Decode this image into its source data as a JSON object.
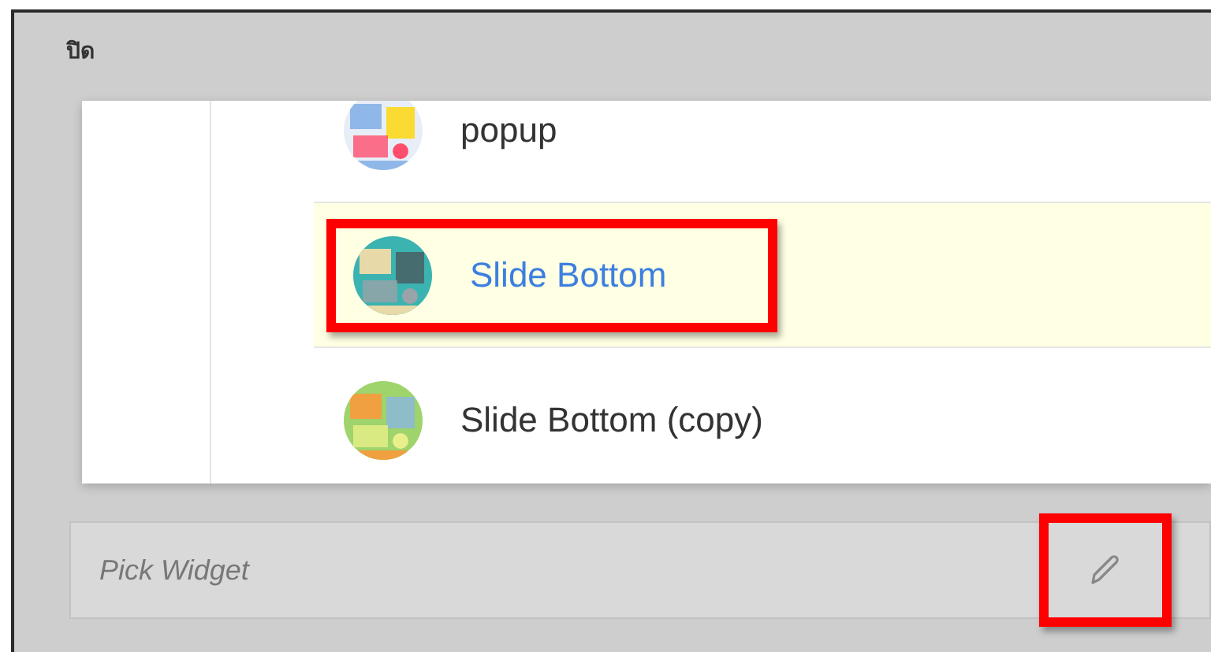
{
  "header": {
    "title": "ปิด"
  },
  "dropdown": {
    "items": [
      {
        "label": "popup",
        "selected": false,
        "annotated": false
      },
      {
        "label": "Slide Bottom",
        "selected": true,
        "annotated": true
      },
      {
        "label": "Slide Bottom (copy)",
        "selected": false,
        "annotated": false
      }
    ]
  },
  "widget_field": {
    "placeholder": "Pick Widget",
    "edit_annotated": true
  }
}
